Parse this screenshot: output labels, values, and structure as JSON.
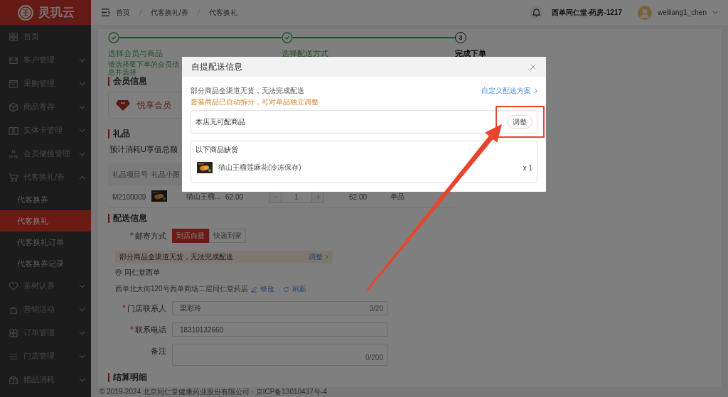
{
  "brand": {
    "name": "灵玑云"
  },
  "sidebar": {
    "items": [
      {
        "label": "首页",
        "kind": "link",
        "selected": false
      },
      {
        "label": "客户管理",
        "kind": "group",
        "expanded": false,
        "selected": false
      },
      {
        "label": "采购管理",
        "kind": "group",
        "expanded": false,
        "selected": false
      },
      {
        "label": "商品寄存",
        "kind": "group",
        "expanded": false,
        "selected": false
      },
      {
        "label": "实体卡管理",
        "kind": "group",
        "expanded": false,
        "selected": false
      },
      {
        "label": "会员储值管理",
        "kind": "group",
        "expanded": false,
        "selected": false
      },
      {
        "label": "代客换礼/券",
        "kind": "group",
        "expanded": true,
        "selected": false,
        "children": [
          {
            "label": "代客换券",
            "selected": false
          },
          {
            "label": "代客换礼",
            "selected": true
          },
          {
            "label": "代客换礼订单",
            "selected": false
          },
          {
            "label": "代客换券记录",
            "selected": false
          }
        ]
      },
      {
        "label": "茶树认养",
        "kind": "group",
        "expanded": false,
        "selected": false
      },
      {
        "label": "营销活动",
        "kind": "group",
        "expanded": false,
        "selected": false
      },
      {
        "label": "订单管理",
        "kind": "group",
        "expanded": false,
        "selected": false
      },
      {
        "label": "门店管理",
        "kind": "group",
        "expanded": false,
        "selected": false
      },
      {
        "label": "赠品消耗",
        "kind": "group",
        "expanded": false,
        "selected": false
      }
    ]
  },
  "header": {
    "breadcrumbs": [
      "首页",
      "代客换礼/券",
      "代客换礼"
    ],
    "store": "西单同仁堂-药房-1217",
    "user": "weiliang1_chen"
  },
  "steps": [
    {
      "title": "选择会员与商品",
      "description": "请选择要下单的会员信息并选择",
      "completed": true
    },
    {
      "title": "选择配送方式",
      "completed": true
    },
    {
      "number": "3",
      "title": "完成下单",
      "completed": false
    }
  ],
  "member": {
    "title": "会员信息",
    "tier": "悦享会员"
  },
  "gifts": {
    "title": "礼品",
    "summary": "预计消耗U享值总额",
    "columns": [
      "礼品项目号",
      "礼品小图"
    ],
    "rows": [
      {
        "code": "M2100009",
        "name": "猫山王榴...",
        "price": "62.00",
        "quantity": "1",
        "subtotal": "62.00",
        "type": "单品"
      }
    ]
  },
  "delivery": {
    "title": "配送信息",
    "method_label": "邮寄方式",
    "methods": [
      {
        "label": "到店自提",
        "selected": true
      },
      {
        "label": "快递到家",
        "selected": false
      }
    ],
    "warning": "部分商品全渠道无货，无法完成配送",
    "warning_action": "调整",
    "store_name": "同仁堂西单",
    "address": "西单北大街120号西单商场二层同仁堂药店",
    "edit": "修改",
    "refresh": "刷新",
    "fields": [
      {
        "label": "门店联系人",
        "required": true,
        "kind": "input",
        "value": "梁彩玲",
        "counter": "3/20"
      },
      {
        "label": "联系电话",
        "required": true,
        "kind": "input",
        "value": "18310132660"
      },
      {
        "label": "备注",
        "required": false,
        "kind": "textarea",
        "counter": "0/200"
      }
    ]
  },
  "settlement": {
    "title": "结算明细"
  },
  "footer": "© 2019-2024 北京同仁堂健康药业股份有限公司 · 京ICP备13010437号-4",
  "modal": {
    "title": "自提配送信息",
    "message": "部分商品全渠道无货，无法完成配送",
    "custom_link": "自定义配送方案",
    "note": "套装商品已自动拆分，可对单品独立调整",
    "store_card": {
      "text": "本店无可配商品",
      "button": "调整"
    },
    "shortage": {
      "title": "以下商品缺货",
      "items": [
        {
          "name": "猫山王榴莲麻花(冷冻保存)",
          "quantity": "x 1"
        }
      ]
    }
  }
}
